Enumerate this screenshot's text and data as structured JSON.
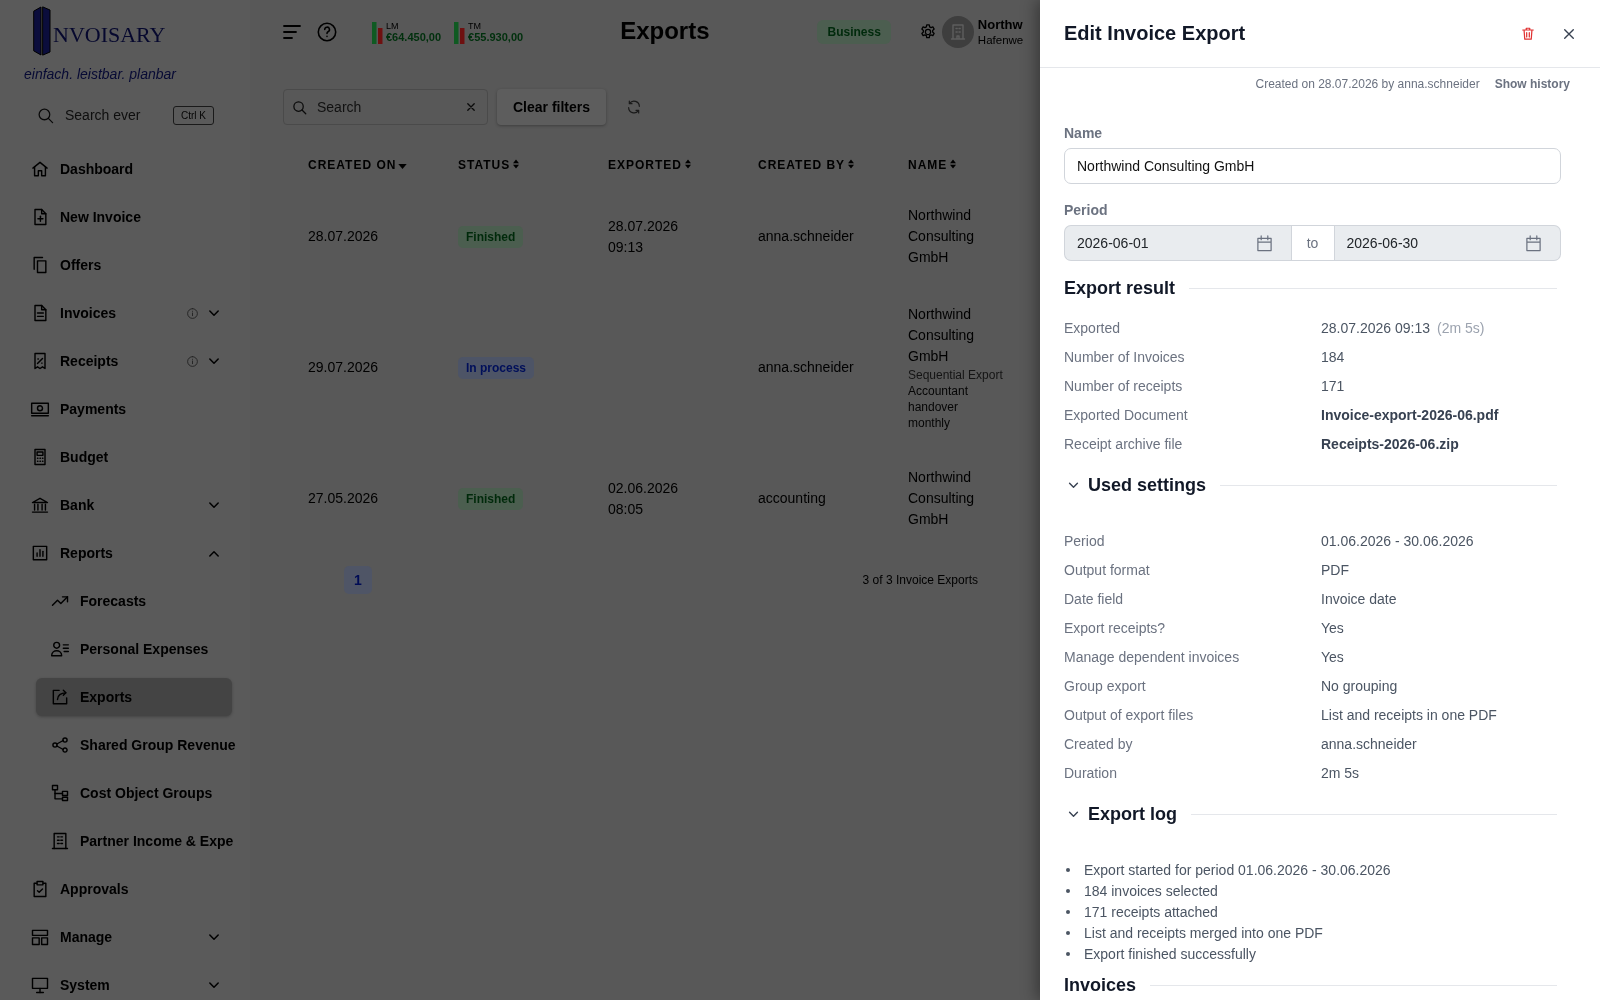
{
  "sidebar": {
    "logo": "NVOISARY",
    "tagline": "einfach. leistbar. planbar",
    "search": {
      "placeholder": "Search ever",
      "shortcut": "Ctrl K"
    },
    "items": [
      {
        "label": "Dashboard",
        "selected": false
      },
      {
        "label": "New Invoice",
        "selected": false
      },
      {
        "label": "Offers",
        "selected": false
      },
      {
        "label": "Invoices",
        "selected": false,
        "info": true,
        "expanded": false
      },
      {
        "label": "Receipts",
        "selected": false,
        "info": true,
        "expanded": false
      },
      {
        "label": "Payments",
        "selected": false
      },
      {
        "label": "Budget",
        "selected": false
      },
      {
        "label": "Bank",
        "selected": false,
        "expanded": false
      },
      {
        "label": "Reports",
        "selected": false,
        "expanded": true,
        "children": [
          {
            "label": "Forecasts",
            "selected": false
          },
          {
            "label": "Personal Expenses",
            "selected": false
          },
          {
            "label": "Exports",
            "selected": true
          },
          {
            "label": "Shared Group Revenue",
            "selected": false
          },
          {
            "label": "Cost Object Groups",
            "selected": false
          },
          {
            "label": "Partner Income & Expe",
            "selected": false
          }
        ]
      },
      {
        "label": "Approvals",
        "selected": false
      },
      {
        "label": "Manage",
        "selected": false,
        "expanded": false
      },
      {
        "label": "System",
        "selected": false,
        "expanded": false
      }
    ]
  },
  "topbar": {
    "stats": [
      {
        "label": "LM",
        "value": "€64.450,00"
      },
      {
        "label": "TM",
        "value": "€55.930,00"
      }
    ],
    "title": "Exports",
    "plan": "Business",
    "account": {
      "name": "Northw",
      "address": "Hafenwe"
    }
  },
  "filters": {
    "search": {
      "placeholder": "Search"
    },
    "clear_button": "Clear filters"
  },
  "table": {
    "columns": [
      {
        "label": "CREATED ON",
        "sorted": true
      },
      {
        "label": "STATUS",
        "sorted": false
      },
      {
        "label": "EXPORTED",
        "sorted": false
      },
      {
        "label": "CREATED BY",
        "sorted": false
      },
      {
        "label": "NAME",
        "sorted": false
      }
    ],
    "rows": [
      {
        "created_on": "28.07.2026",
        "status": {
          "label": "Finished",
          "kind": "finished"
        },
        "exported": "28.07.2026 09:13",
        "created_by": "anna.schneider",
        "name": "Northwind Consulting GmbH"
      },
      {
        "created_on": "29.07.2026",
        "status": {
          "label": "In process",
          "kind": "in_process"
        },
        "created_by": "anna.schneider",
        "name": "Northwind Consulting GmbH",
        "tag": "Sequential Export",
        "description": "Accountant handover monthly"
      },
      {
        "created_on": "27.05.2026",
        "status": {
          "label": "Finished",
          "kind": "finished"
        },
        "exported": "02.06.2026 08:05",
        "created_by": "accounting",
        "name": "Northwind Consulting GmbH"
      }
    ]
  },
  "pagination": {
    "pages": [
      {
        "label": "1",
        "selected": true
      }
    ],
    "summary": "3 of 3 Invoice Exports"
  },
  "panel": {
    "title": "Edit Invoice Export",
    "meta": "Created on 28.07.2026 by anna.schneider",
    "history_link": "Show history",
    "name_field": {
      "label": "Name",
      "value": "Northwind Consulting GmbH"
    },
    "period": {
      "label": "Period",
      "from": "2026-06-01",
      "separator": "to",
      "to": "2026-06-30"
    },
    "sections": [
      {
        "kind": "details",
        "title": "Export result",
        "rows": [
          {
            "label": "Exported",
            "value": "28.07.2026 09:13",
            "note": "(2m 5s)"
          },
          {
            "label": "Number of Invoices",
            "value": "184"
          },
          {
            "label": "Number of receipts",
            "value": "171"
          },
          {
            "label": "Exported Document",
            "value": "Invoice-export-2026-06.pdf",
            "bold": true
          },
          {
            "label": "Receipt archive file",
            "value": "Receipts-2026-06.zip",
            "bold": true
          }
        ]
      },
      {
        "kind": "details",
        "title": "Used settings",
        "expanded": true,
        "rows": [
          {
            "label": "Period",
            "value": "01.06.2026 - 30.06.2026"
          },
          {
            "label": "Output format",
            "value": "PDF"
          },
          {
            "label": "Date field",
            "value": "Invoice date"
          },
          {
            "label": "Export receipts?",
            "value": "Yes"
          },
          {
            "label": "Manage dependent invoices",
            "value": "Yes"
          },
          {
            "label": "Group export",
            "value": "No grouping"
          },
          {
            "label": "Output of export files",
            "value": "List and receipts in one PDF"
          },
          {
            "label": "Created by",
            "value": "anna.schneider"
          },
          {
            "label": "Duration",
            "value": "2m 5s"
          }
        ]
      },
      {
        "kind": "log",
        "title": "Export log",
        "expanded": true,
        "entries": [
          "Export started for period 01.06.2026 - 30.06.2026",
          "184 invoices selected",
          "171 receipts attached",
          "List and receipts merged into one PDF",
          "Export finished successfully"
        ]
      },
      {
        "kind": "details",
        "title": "Invoices"
      }
    ]
  }
}
